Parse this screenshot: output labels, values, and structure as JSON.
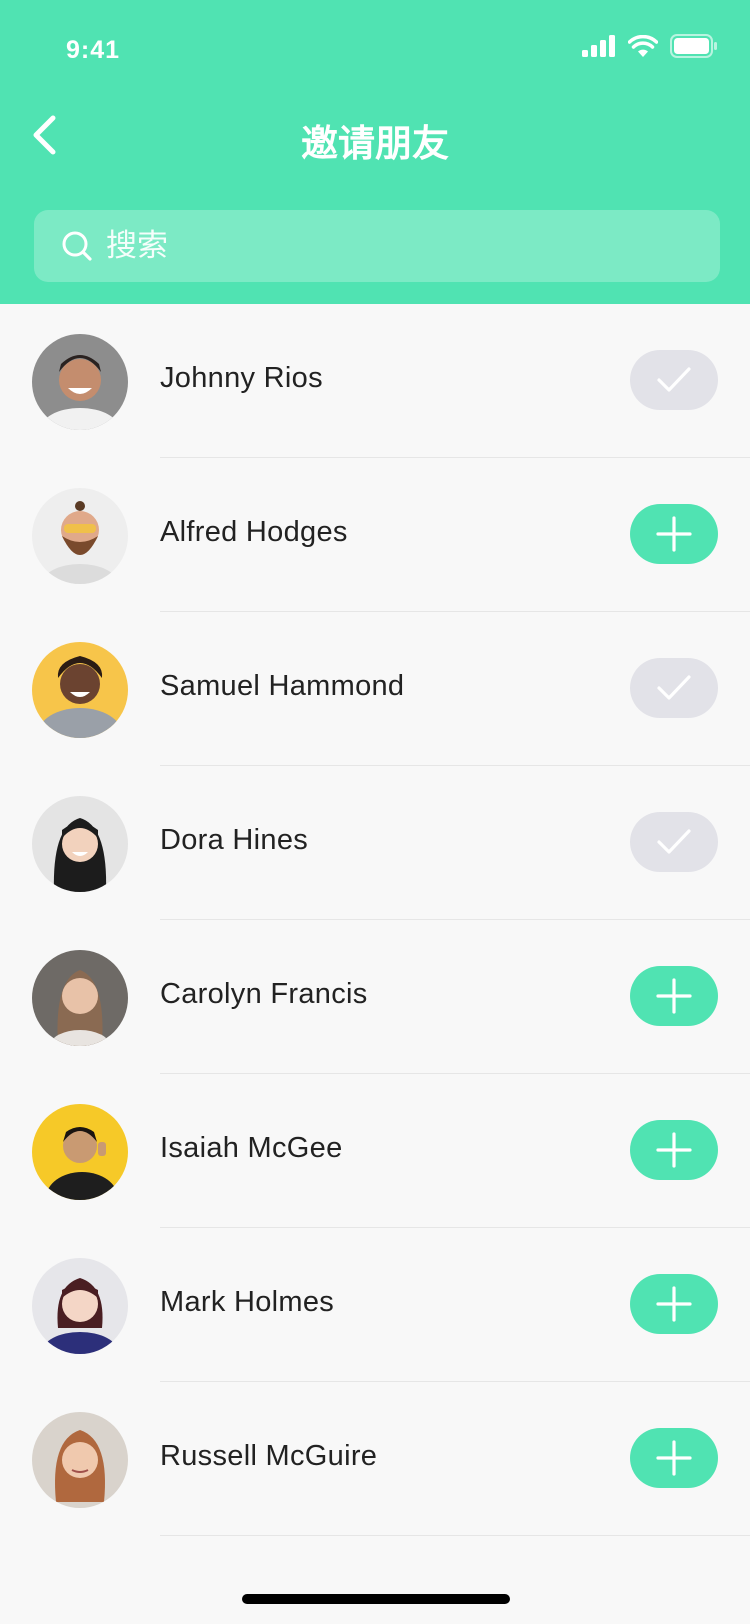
{
  "status_bar": {
    "time": "9:41"
  },
  "nav": {
    "title": "邀请朋友"
  },
  "search": {
    "placeholder": "搜索"
  },
  "contacts": [
    {
      "name": "Johnny Rios",
      "status": "invited"
    },
    {
      "name": "Alfred Hodges",
      "status": "add"
    },
    {
      "name": "Samuel Hammond",
      "status": "invited"
    },
    {
      "name": "Dora Hines",
      "status": "invited"
    },
    {
      "name": "Carolyn Francis",
      "status": "add"
    },
    {
      "name": "Isaiah McGee",
      "status": "add"
    },
    {
      "name": "Mark Holmes",
      "status": "add"
    },
    {
      "name": "Russell McGuire",
      "status": "add"
    }
  ],
  "colors": {
    "accent": "#50e3b2",
    "invited_button": "#e2e2e8",
    "background": "#f8f8f8"
  }
}
